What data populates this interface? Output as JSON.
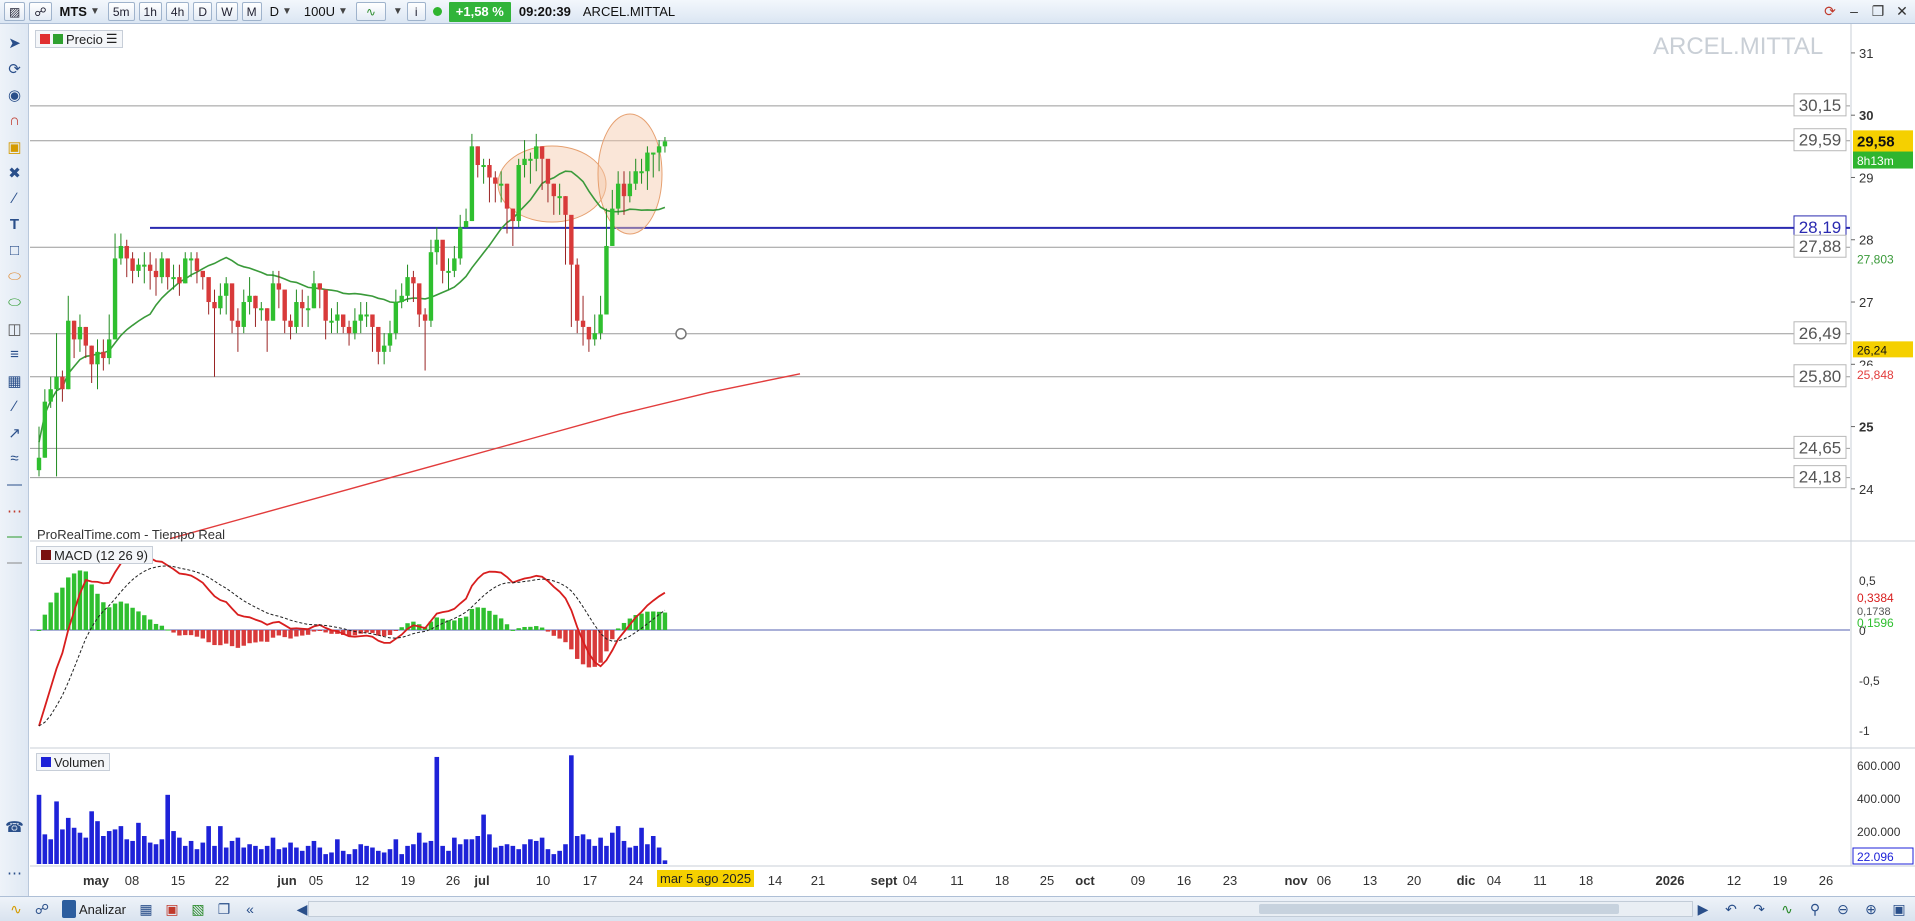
{
  "toolbar": {
    "symbol": "MTS",
    "timeframes": [
      "5m",
      "1h",
      "4h",
      "D",
      "W",
      "M"
    ],
    "period": "D",
    "units": "100U",
    "change_pct": "+1,58 %",
    "time": "09:20:39",
    "instrument": "ARCEL.MITTAL"
  },
  "price_panel": {
    "label": "Precio",
    "watermark": "ARCEL.MITTAL",
    "source": "ProRealTime.com - Tiempo Real",
    "current_price": "29,58",
    "countdown": "8h13m",
    "ma_short_label": "27,803",
    "ma_long_label": "25,848",
    "low_marker_label": "26,24",
    "hlines": [
      {
        "label": "30,15",
        "value": 30.15
      },
      {
        "label": "29,59",
        "value": 29.59
      },
      {
        "label": "28,19",
        "value": 28.19,
        "highlight": true
      },
      {
        "label": "27,88",
        "value": 27.88
      },
      {
        "label": "26,49",
        "value": 26.49
      },
      {
        "label": "25,80",
        "value": 25.8
      },
      {
        "label": "24,65",
        "value": 24.65
      },
      {
        "label": "24,18",
        "value": 24.18
      }
    ],
    "yaxis_ticks": [
      "31",
      "30",
      "29",
      "28",
      "27",
      "26",
      "25",
      "24"
    ]
  },
  "macd_panel": {
    "label": "MACD (12 26 9)",
    "macd_value": "0,3384",
    "signal_value": "0,1738",
    "hist_value": "0,1596",
    "yaxis_ticks": [
      "0,5",
      "0",
      "-0,5",
      "-1"
    ]
  },
  "volume_panel": {
    "label": "Volumen",
    "current_volume": "22.096",
    "yaxis_ticks": [
      "600.000",
      "400.000",
      "200.000"
    ]
  },
  "xaxis": {
    "labels": [
      "may",
      "08",
      "15",
      "22",
      "jun",
      "05",
      "12",
      "19",
      "26",
      "jul",
      "10",
      "17",
      "24",
      "mar 5 ago 2025",
      "14",
      "21",
      "sept",
      "04",
      "11",
      "18",
      "25",
      "oct",
      "09",
      "16",
      "23",
      "nov",
      "06",
      "13",
      "20",
      "dic",
      "04",
      "11",
      "18",
      "2026",
      "12",
      "19",
      "26"
    ]
  },
  "bottom": {
    "analyze_label": "Analizar"
  },
  "colors": {
    "up": "#2fbf2f",
    "down": "#d83a3a",
    "volume": "#1e22d8",
    "ma_short": "#3a9a3a",
    "ma_long": "#e23c3c",
    "macd_line": "#d81e1e",
    "signal_line": "#222222",
    "support_line": "#2a2ab0",
    "highlight": "#f5d000",
    "current": "#f5d000",
    "countdown_bg": "#2fb52f",
    "ellipse": "#f3c8a8"
  },
  "chart_data": {
    "type": "candlestick",
    "close": [
      24.5,
      25.4,
      25.6,
      25.8,
      25.6,
      26.7,
      26.4,
      26.6,
      26.3,
      26.0,
      26.2,
      26.1,
      26.4,
      27.7,
      27.9,
      27.7,
      27.5,
      27.6,
      27.6,
      27.5,
      27.4,
      27.7,
      27.4,
      27.4,
      27.3,
      27.7,
      27.7,
      27.5,
      27.4,
      27.0,
      26.9,
      27.1,
      27.3,
      26.7,
      26.6,
      27.0,
      27.1,
      26.9,
      26.9,
      26.7,
      27.3,
      27.2,
      26.7,
      26.6,
      27.0,
      26.9,
      26.9,
      27.3,
      27.2,
      26.7,
      26.7,
      26.8,
      26.6,
      26.5,
      26.7,
      26.8,
      26.8,
      26.6,
      26.2,
      26.3,
      26.5,
      27.0,
      27.1,
      27.4,
      27.3,
      26.8,
      26.7,
      27.8,
      28.0,
      27.5,
      27.5,
      27.7,
      28.2,
      28.3,
      29.5,
      29.2,
      29.2,
      29.0,
      28.9,
      28.9,
      28.5,
      28.3,
      29.2,
      29.3,
      29.3,
      29.5,
      29.3,
      28.9,
      28.7,
      28.7,
      28.4,
      27.6,
      26.7,
      26.6,
      26.4,
      26.5,
      26.8,
      27.9,
      28.5,
      28.9,
      28.7,
      28.9,
      29.1,
      29.1,
      29.4,
      29.4,
      29.5,
      29.58
    ],
    "high": [
      25.0,
      25.6,
      25.8,
      26.5,
      25.9,
      27.1,
      26.7,
      26.8,
      26.6,
      26.3,
      26.4,
      26.4,
      26.8,
      28.1,
      28.1,
      28.0,
      27.8,
      27.7,
      27.8,
      27.8,
      27.7,
      27.8,
      27.7,
      27.6,
      27.6,
      27.8,
      27.8,
      27.8,
      27.5,
      27.2,
      27.2,
      27.3,
      27.4,
      26.9,
      26.9,
      27.2,
      27.4,
      27.1,
      27.0,
      26.9,
      27.5,
      27.5,
      26.9,
      26.8,
      27.2,
      27.2,
      27.1,
      27.5,
      27.3,
      26.9,
      26.9,
      27.0,
      26.8,
      26.7,
      26.9,
      27.0,
      27.0,
      26.8,
      26.5,
      26.5,
      26.7,
      27.2,
      27.3,
      27.6,
      27.5,
      27.0,
      26.9,
      28.0,
      28.2,
      27.8,
      27.7,
      27.9,
      28.4,
      28.5,
      29.7,
      29.5,
      29.3,
      29.3,
      29.1,
      29.1,
      28.9,
      28.5,
      29.3,
      29.6,
      29.4,
      29.7,
      29.5,
      29.2,
      28.9,
      28.9,
      28.7,
      28.1,
      27.7,
      27.1,
      26.6,
      26.8,
      27.1,
      28.5,
      28.8,
      29.1,
      29.1,
      29.1,
      29.3,
      29.3,
      29.5,
      29.4,
      29.6,
      29.65
    ],
    "low": [
      24.2,
      24.5,
      25.3,
      24.2,
      25.4,
      25.6,
      26.1,
      26.2,
      26.1,
      25.7,
      25.6,
      25.9,
      26.0,
      26.4,
      27.6,
      27.4,
      27.3,
      27.4,
      27.3,
      27.2,
      27.1,
      27.3,
      27.2,
      27.2,
      27.1,
      27.3,
      27.4,
      27.3,
      27.2,
      26.8,
      25.8,
      26.8,
      26.8,
      26.5,
      26.2,
      26.5,
      26.8,
      26.6,
      26.7,
      26.2,
      26.7,
      26.9,
      26.5,
      26.4,
      26.5,
      26.6,
      26.6,
      26.9,
      26.9,
      26.4,
      26.5,
      26.5,
      26.5,
      26.3,
      26.4,
      26.5,
      26.6,
      26.2,
      26.0,
      26.0,
      26.2,
      26.4,
      26.9,
      27.0,
      27.0,
      26.6,
      25.9,
      26.6,
      27.6,
      27.3,
      27.2,
      27.4,
      27.6,
      28.2,
      28.3,
      29.0,
      28.9,
      28.6,
      28.6,
      28.6,
      28.1,
      27.9,
      28.2,
      29.0,
      28.9,
      29.1,
      28.8,
      28.6,
      28.4,
      28.4,
      27.6,
      26.6,
      26.5,
      26.3,
      26.2,
      26.3,
      26.4,
      26.8,
      27.9,
      28.4,
      28.4,
      28.6,
      28.8,
      28.9,
      28.8,
      29.0,
      29.1,
      29.4
    ],
    "volume": [
      420000,
      180000,
      150000,
      380000,
      210000,
      280000,
      220000,
      190000,
      160000,
      320000,
      260000,
      170000,
      200000,
      210000,
      230000,
      150000,
      140000,
      250000,
      170000,
      130000,
      120000,
      150000,
      420000,
      200000,
      160000,
      110000,
      140000,
      90000,
      130000,
      230000,
      110000,
      230000,
      100000,
      140000,
      160000,
      100000,
      120000,
      110000,
      90000,
      110000,
      160000,
      90000,
      100000,
      130000,
      100000,
      80000,
      110000,
      140000,
      100000,
      60000,
      70000,
      150000,
      80000,
      60000,
      90000,
      120000,
      110000,
      100000,
      80000,
      70000,
      90000,
      150000,
      60000,
      110000,
      120000,
      190000,
      130000,
      140000,
      650000,
      110000,
      80000,
      160000,
      120000,
      150000,
      150000,
      170000,
      300000,
      180000,
      100000,
      110000,
      120000,
      110000,
      90000,
      120000,
      150000,
      140000,
      160000,
      90000,
      60000,
      80000,
      120000,
      660000,
      170000,
      180000,
      150000,
      110000,
      160000,
      110000,
      190000,
      230000,
      140000,
      100000,
      110000,
      220000,
      120000,
      170000,
      100000,
      22096
    ],
    "ylim": [
      23.5,
      31.4
    ],
    "series": [
      {
        "name": "MACD (12 26 9)",
        "values": []
      }
    ]
  }
}
